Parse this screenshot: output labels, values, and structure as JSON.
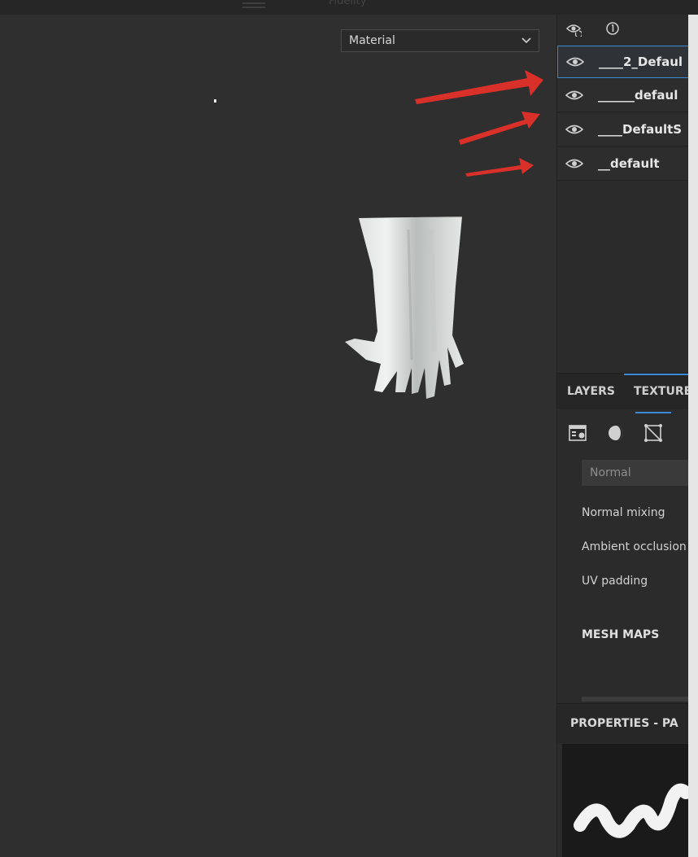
{
  "topbar": {
    "title": "Fidelity"
  },
  "viewport": {
    "material_select": {
      "value": "Material"
    }
  },
  "texture_sets": {
    "header_icons": [
      "eye-refresh-icon",
      "info-circle-icon"
    ],
    "items": [
      {
        "name": "____2_Defaul",
        "selected": true
      },
      {
        "name": "______defaul",
        "selected": false
      },
      {
        "name": "____DefaultS",
        "selected": false
      },
      {
        "name": "__default",
        "selected": false
      }
    ]
  },
  "tabs": {
    "layers": "LAYERS",
    "texture": "TEXTURE"
  },
  "settings": {
    "normal_dropdown": "Normal",
    "normal_mixing": "Normal mixing",
    "ambient_occlusion": "Ambient occlusion",
    "uv_padding": "UV padding",
    "mesh_maps": "MESH MAPS"
  },
  "properties": {
    "title": "PROPERTIES - PA"
  },
  "colors": {
    "accent": "#3b8ad8",
    "arrow": "#d9302a",
    "panel": "#2b2b2b",
    "viewport": "#2f2f2f"
  }
}
